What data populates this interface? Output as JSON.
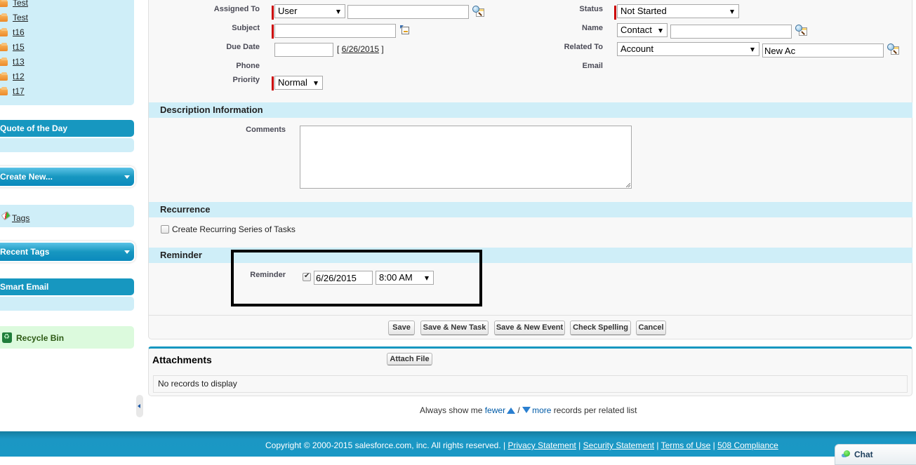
{
  "sidebar": {
    "recent_items": [
      {
        "label": "Test"
      },
      {
        "label": "Test"
      },
      {
        "label": "t16"
      },
      {
        "label": "t15"
      },
      {
        "label": "t13"
      },
      {
        "label": "t12"
      },
      {
        "label": "t17"
      }
    ],
    "quote_of_day": "Quote of the Day",
    "create_new": "Create New...",
    "tags_link": "Tags",
    "recent_tags": "Recent Tags",
    "smart_email": "Smart Email",
    "recycle_bin": "Recycle Bin"
  },
  "form": {
    "assigned_to": {
      "label": "Assigned To",
      "type_value": "User",
      "value": ""
    },
    "subject": {
      "label": "Subject",
      "value": ""
    },
    "due_date": {
      "label": "Due Date",
      "value": "",
      "today_link": "6/26/2015",
      "bracket_open": "[",
      "bracket_close": "]"
    },
    "phone": {
      "label": "Phone",
      "value": ""
    },
    "priority": {
      "label": "Priority",
      "value": "Normal"
    },
    "status": {
      "label": "Status",
      "value": "Not Started"
    },
    "name": {
      "label": "Name",
      "type_value": "Contact",
      "value": ""
    },
    "related_to": {
      "label": "Related To",
      "type_value": "Account",
      "value": "New Ac"
    },
    "email": {
      "label": "Email",
      "value": ""
    }
  },
  "sections": {
    "description": "Description Information",
    "recurrence": "Recurrence",
    "reminder": "Reminder"
  },
  "description": {
    "comments_label": "Comments",
    "comments_value": ""
  },
  "recurrence": {
    "checkbox_label": "Create Recurring Series of Tasks",
    "checked": false
  },
  "reminder": {
    "label": "Reminder",
    "checked": true,
    "date": "6/26/2015",
    "time": "8:00 AM"
  },
  "buttons": {
    "save": "Save",
    "save_new_task": "Save & New Task",
    "save_new_event": "Save & New Event",
    "check_spelling": "Check Spelling",
    "cancel": "Cancel"
  },
  "attachments": {
    "title": "Attachments",
    "attach_button": "Attach File",
    "empty_text": "No records to display"
  },
  "related_list_pref": {
    "prefix": "Always show me",
    "fewer": "fewer",
    "separator": "/",
    "more": "more",
    "suffix": "records per related list"
  },
  "footer": {
    "copyright": "Copyright © 2000-2015 salesforce.com, inc. All rights reserved.",
    "links": [
      "Privacy Statement",
      "Security Statement",
      "Terms of Use",
      "508 Compliance"
    ]
  },
  "chat": {
    "label": "Chat"
  },
  "colors": {
    "brand_blue": "#1797c0",
    "section_bg": "#cfeef8",
    "required": "#cc0000",
    "recycle_bg": "#dcfadd"
  }
}
